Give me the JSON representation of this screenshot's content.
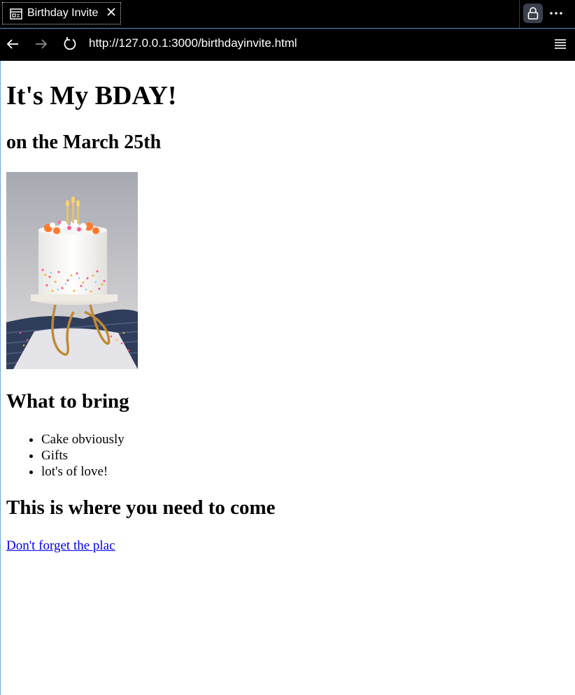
{
  "browser": {
    "tab_title": "Birthday Invite",
    "url": "http://127.0.0.1:3000/birthdayinvite.html",
    "icons": [
      "page-icon",
      "close-icon",
      "lock-icon",
      "more-icon",
      "back-arrow-icon",
      "forward-arrow-icon",
      "reload-icon",
      "menu-icon"
    ]
  },
  "page": {
    "title": "It's My BDAY!",
    "date_line": "on the March 25th",
    "image_description": "birthday cake with candles and sprinkles on a gold stand",
    "bring_heading": "What to bring",
    "bring_items": [
      "Cake obviously",
      "Gifts",
      "lot's of love!"
    ],
    "where_heading": "This is where you need to come",
    "place_link": "Don't forget the plac"
  },
  "colors": {
    "chrome_background": "#000000",
    "page_background": "#ffffff",
    "link": "#0000ee",
    "frame_accent": "#6fa8dc"
  }
}
